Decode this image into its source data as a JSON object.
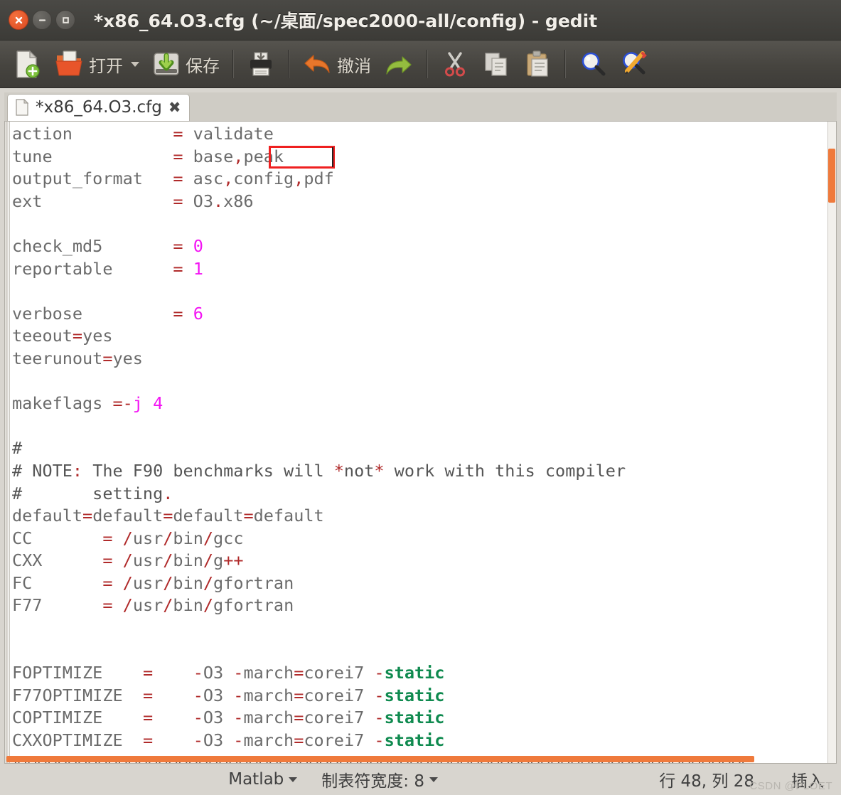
{
  "window": {
    "title": "*x86_64.O3.cfg (~/桌面/spec2000-all/config) - gedit",
    "controls": {
      "close": "close-button",
      "minimize": "minimize-button",
      "maximize": "maximize-button"
    }
  },
  "toolbar": {
    "new_label": "",
    "open_label": "打开",
    "save_label": "保存",
    "print_label": "",
    "undo_label": "撤消",
    "redo_label": "",
    "cut_label": "",
    "copy_label": "",
    "paste_label": "",
    "find_label": "",
    "replace_label": ""
  },
  "tab": {
    "title": "*x86_64.O3.cfg",
    "close": "✖"
  },
  "editor": {
    "selection_text": "peak",
    "selection_color": "#ef2020",
    "lines": [
      {
        "segments": [
          {
            "t": "action          ",
            "c": "id"
          },
          {
            "t": "=",
            "c": "op"
          },
          {
            "t": " validate",
            "c": "id"
          }
        ]
      },
      {
        "segments": [
          {
            "t": "tune            ",
            "c": "id"
          },
          {
            "t": "=",
            "c": "op"
          },
          {
            "t": " base",
            "c": "id"
          },
          {
            "t": ",",
            "c": "op"
          },
          {
            "t": "peak",
            "c": "id"
          }
        ]
      },
      {
        "segments": [
          {
            "t": "output_format   ",
            "c": "id"
          },
          {
            "t": "=",
            "c": "op"
          },
          {
            "t": " asc",
            "c": "id"
          },
          {
            "t": ",",
            "c": "op"
          },
          {
            "t": "config",
            "c": "id"
          },
          {
            "t": ",",
            "c": "op"
          },
          {
            "t": "pdf",
            "c": "id"
          }
        ]
      },
      {
        "segments": [
          {
            "t": "ext             ",
            "c": "id"
          },
          {
            "t": "=",
            "c": "op"
          },
          {
            "t": " O3",
            "c": "id"
          },
          {
            "t": ".",
            "c": "op"
          },
          {
            "t": "x86",
            "c": "id"
          }
        ]
      },
      {
        "segments": []
      },
      {
        "segments": [
          {
            "t": "check_md5       ",
            "c": "id"
          },
          {
            "t": "=",
            "c": "op"
          },
          {
            "t": " ",
            "c": "id"
          },
          {
            "t": "0",
            "c": "num"
          }
        ]
      },
      {
        "segments": [
          {
            "t": "reportable      ",
            "c": "id"
          },
          {
            "t": "=",
            "c": "op"
          },
          {
            "t": " ",
            "c": "id"
          },
          {
            "t": "1",
            "c": "num"
          }
        ]
      },
      {
        "segments": []
      },
      {
        "segments": [
          {
            "t": "verbose         ",
            "c": "id"
          },
          {
            "t": "=",
            "c": "op"
          },
          {
            "t": " ",
            "c": "id"
          },
          {
            "t": "6",
            "c": "num"
          }
        ]
      },
      {
        "segments": [
          {
            "t": "teeout",
            "c": "id"
          },
          {
            "t": "=",
            "c": "op"
          },
          {
            "t": "yes",
            "c": "id"
          }
        ]
      },
      {
        "segments": [
          {
            "t": "teerunout",
            "c": "id"
          },
          {
            "t": "=",
            "c": "op"
          },
          {
            "t": "yes",
            "c": "id"
          }
        ]
      },
      {
        "segments": []
      },
      {
        "segments": [
          {
            "t": "makeflags ",
            "c": "id"
          },
          {
            "t": "=-",
            "c": "op"
          },
          {
            "t": "j",
            "c": "num"
          },
          {
            "t": " ",
            "c": "id"
          },
          {
            "t": "4",
            "c": "num"
          }
        ]
      },
      {
        "segments": []
      },
      {
        "segments": [
          {
            "t": "#",
            "c": "cmt"
          }
        ]
      },
      {
        "segments": [
          {
            "t": "# NOTE",
            "c": "cmt"
          },
          {
            "t": ":",
            "c": "op"
          },
          {
            "t": " The F90 benchmarks will ",
            "c": "cmt"
          },
          {
            "t": "*",
            "c": "op"
          },
          {
            "t": "not",
            "c": "cmt"
          },
          {
            "t": "*",
            "c": "op"
          },
          {
            "t": " work with this compiler",
            "c": "cmt"
          }
        ]
      },
      {
        "segments": [
          {
            "t": "#       setting",
            "c": "cmt"
          },
          {
            "t": ".",
            "c": "op"
          }
        ]
      },
      {
        "segments": [
          {
            "t": "default",
            "c": "id"
          },
          {
            "t": "=",
            "c": "op"
          },
          {
            "t": "default",
            "c": "id"
          },
          {
            "t": "=",
            "c": "op"
          },
          {
            "t": "default",
            "c": "id"
          },
          {
            "t": "=",
            "c": "op"
          },
          {
            "t": "default",
            "c": "id"
          }
        ]
      },
      {
        "segments": [
          {
            "t": "CC       ",
            "c": "id"
          },
          {
            "t": "=",
            "c": "op"
          },
          {
            "t": " ",
            "c": "id"
          },
          {
            "t": "/",
            "c": "op"
          },
          {
            "t": "usr",
            "c": "id"
          },
          {
            "t": "/",
            "c": "op"
          },
          {
            "t": "bin",
            "c": "id"
          },
          {
            "t": "/",
            "c": "op"
          },
          {
            "t": "gcc",
            "c": "id"
          }
        ]
      },
      {
        "segments": [
          {
            "t": "CXX      ",
            "c": "id"
          },
          {
            "t": "=",
            "c": "op"
          },
          {
            "t": " ",
            "c": "id"
          },
          {
            "t": "/",
            "c": "op"
          },
          {
            "t": "usr",
            "c": "id"
          },
          {
            "t": "/",
            "c": "op"
          },
          {
            "t": "bin",
            "c": "id"
          },
          {
            "t": "/",
            "c": "op"
          },
          {
            "t": "g",
            "c": "id"
          },
          {
            "t": "++",
            "c": "op"
          }
        ]
      },
      {
        "segments": [
          {
            "t": "FC       ",
            "c": "id"
          },
          {
            "t": "=",
            "c": "op"
          },
          {
            "t": " ",
            "c": "id"
          },
          {
            "t": "/",
            "c": "op"
          },
          {
            "t": "usr",
            "c": "id"
          },
          {
            "t": "/",
            "c": "op"
          },
          {
            "t": "bin",
            "c": "id"
          },
          {
            "t": "/",
            "c": "op"
          },
          {
            "t": "gfortran",
            "c": "id"
          }
        ]
      },
      {
        "segments": [
          {
            "t": "F77      ",
            "c": "id"
          },
          {
            "t": "=",
            "c": "op"
          },
          {
            "t": " ",
            "c": "id"
          },
          {
            "t": "/",
            "c": "op"
          },
          {
            "t": "usr",
            "c": "id"
          },
          {
            "t": "/",
            "c": "op"
          },
          {
            "t": "bin",
            "c": "id"
          },
          {
            "t": "/",
            "c": "op"
          },
          {
            "t": "gfortran",
            "c": "id"
          }
        ]
      },
      {
        "segments": []
      },
      {
        "segments": []
      },
      {
        "segments": [
          {
            "t": "FOPTIMIZE    ",
            "c": "id"
          },
          {
            "t": "=",
            "c": "op"
          },
          {
            "t": "    ",
            "c": "id"
          },
          {
            "t": "-",
            "c": "op"
          },
          {
            "t": "O3 ",
            "c": "id"
          },
          {
            "t": "-",
            "c": "op"
          },
          {
            "t": "march",
            "c": "id"
          },
          {
            "t": "=",
            "c": "op"
          },
          {
            "t": "corei7 ",
            "c": "id"
          },
          {
            "t": "-",
            "c": "op"
          },
          {
            "t": "static",
            "c": "kwgreen"
          }
        ]
      },
      {
        "segments": [
          {
            "t": "F77OPTIMIZE  ",
            "c": "id"
          },
          {
            "t": "=",
            "c": "op"
          },
          {
            "t": "    ",
            "c": "id"
          },
          {
            "t": "-",
            "c": "op"
          },
          {
            "t": "O3 ",
            "c": "id"
          },
          {
            "t": "-",
            "c": "op"
          },
          {
            "t": "march",
            "c": "id"
          },
          {
            "t": "=",
            "c": "op"
          },
          {
            "t": "corei7 ",
            "c": "id"
          },
          {
            "t": "-",
            "c": "op"
          },
          {
            "t": "static",
            "c": "kwgreen"
          }
        ]
      },
      {
        "segments": [
          {
            "t": "COPTIMIZE    ",
            "c": "id"
          },
          {
            "t": "=",
            "c": "op"
          },
          {
            "t": "    ",
            "c": "id"
          },
          {
            "t": "-",
            "c": "op"
          },
          {
            "t": "O3 ",
            "c": "id"
          },
          {
            "t": "-",
            "c": "op"
          },
          {
            "t": "march",
            "c": "id"
          },
          {
            "t": "=",
            "c": "op"
          },
          {
            "t": "corei7 ",
            "c": "id"
          },
          {
            "t": "-",
            "c": "op"
          },
          {
            "t": "static",
            "c": "kwgreen"
          }
        ]
      },
      {
        "segments": [
          {
            "t": "CXXOPTIMIZE  ",
            "c": "id"
          },
          {
            "t": "=",
            "c": "op"
          },
          {
            "t": "    ",
            "c": "id"
          },
          {
            "t": "-",
            "c": "op"
          },
          {
            "t": "O3 ",
            "c": "id"
          },
          {
            "t": "-",
            "c": "op"
          },
          {
            "t": "march",
            "c": "id"
          },
          {
            "t": "=",
            "c": "op"
          },
          {
            "t": "corei7 ",
            "c": "id"
          },
          {
            "t": "-",
            "c": "op"
          },
          {
            "t": "static",
            "c": "kwgreen"
          }
        ]
      },
      {
        "segments": [
          {
            "t": "#########################################################################",
            "c": "cmt"
          }
        ]
      }
    ]
  },
  "statusbar": {
    "language": "Matlab",
    "tab_width": "制表符宽度: 8",
    "position": "行 48, 列 28",
    "insert_mode": "插入",
    "watermark": "CSDN @PLOET"
  },
  "colors": {
    "accent_orange": "#ef7a3c",
    "titlebar": "#3c3b37",
    "operator_red": "#b02a2a",
    "number_magenta": "#f313f3",
    "keyword_green": "#0f8a4f"
  }
}
